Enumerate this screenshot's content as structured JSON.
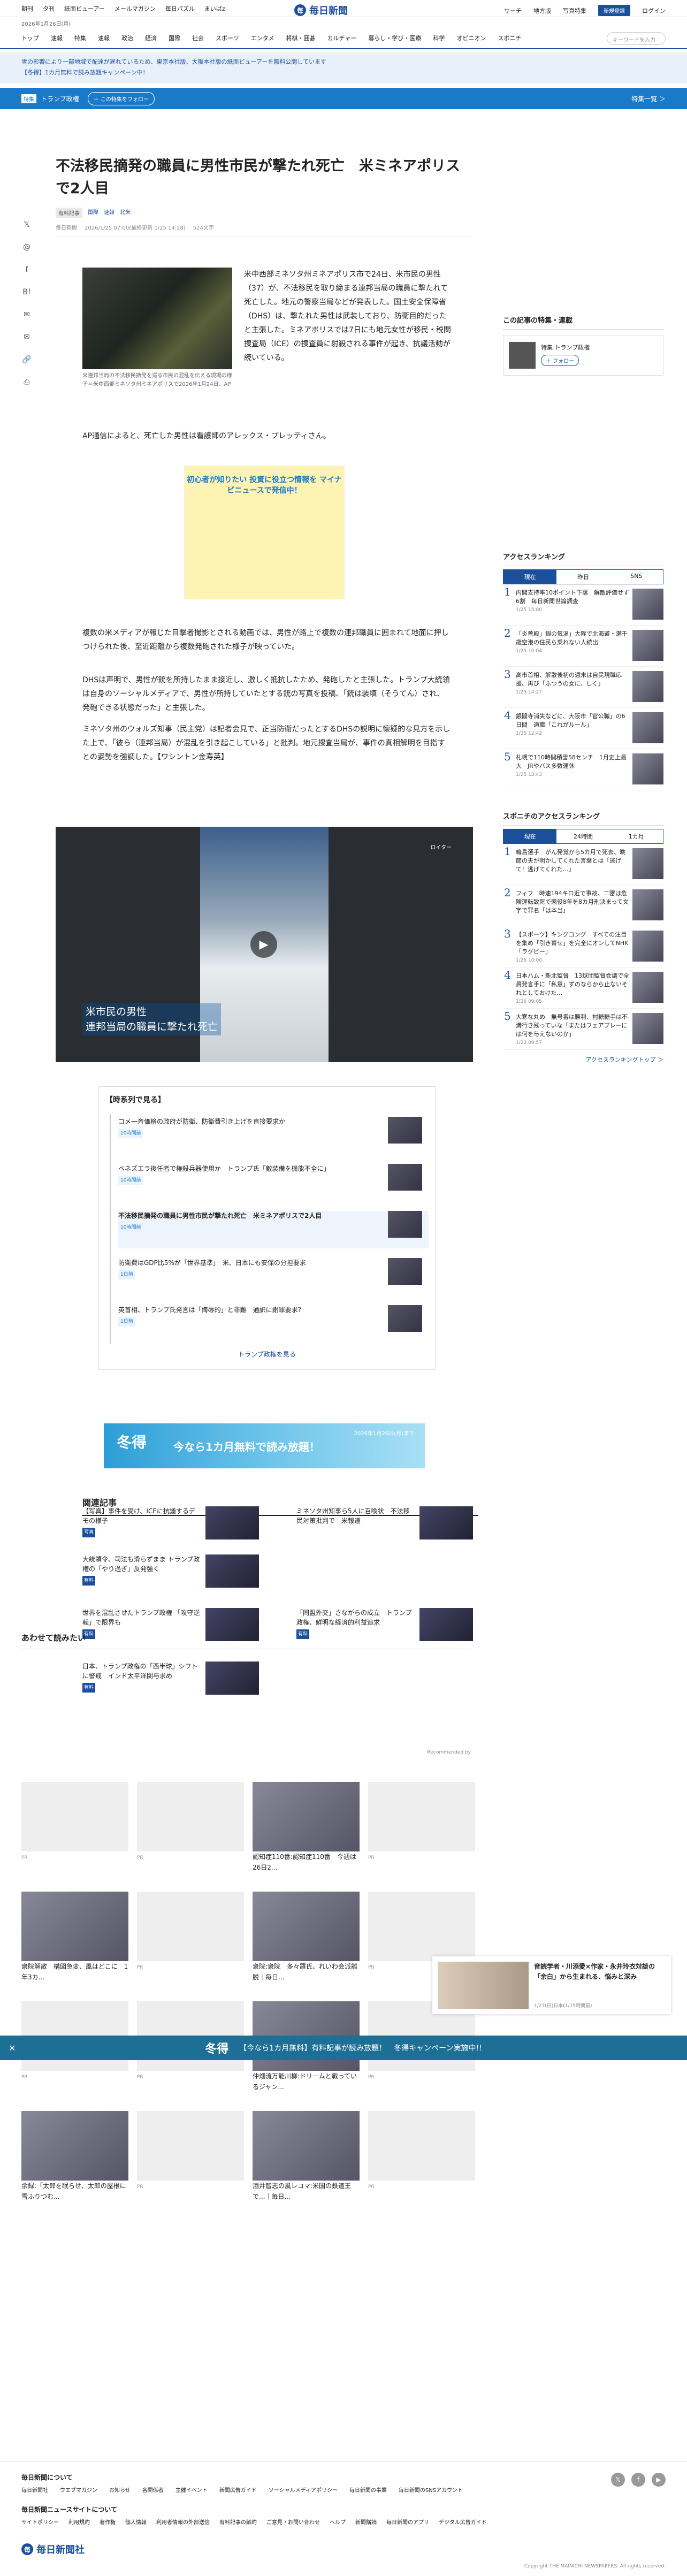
{
  "topnav": {
    "items": [
      "朝刊",
      "夕刊",
      "紙面ビューアー",
      "メールマガジン",
      "毎日パズル",
      "まいばz"
    ],
    "logo": "毎日新聞",
    "right": [
      "写真特集",
      "地方版",
      "サーチ"
    ],
    "subscribe": "新規登録",
    "login": "ログイン"
  },
  "date": "2026年1月26日(月)",
  "categories": [
    "トップ",
    "速報",
    "特集",
    "速報",
    "政治",
    "経済",
    "国際",
    "社会",
    "スポーツ",
    "エンタメ",
    "将棋・囲碁",
    "カルチャー",
    "暮らし・学び・医療",
    "科学",
    "オピニオン",
    "スポニチ"
  ],
  "search_placeholder": "キーワードを入力",
  "notices": [
    "雪の影響により一部地域で配達が遅れているため、東京本社版、大阪本社版の紙面ビューアーを無料公開しています",
    "【冬得】1カ月無料で読み放題キャンペーン中！"
  ],
  "topic": {
    "tag": "特集",
    "name": "トランプ政権",
    "follow": "＋ この特集をフォロー",
    "more": "特集一覧 ＞"
  },
  "article": {
    "title": "不法移民摘発の職員に男性市民が撃たれ死亡　米ミネアポリスで2人目",
    "tags": [
      "有料記事",
      "国際",
      "速報",
      "北米"
    ],
    "meta": [
      "毎日新聞",
      "2026/1/25 07:00(最終更新 1/25 14:28)",
      "524文字"
    ],
    "caption": "米連邦当局の不法移民摘発を巡る市民の混乱を伝える現場の様子＝米中西部ミネソタ州ミネアポリスで2026年1月24日、AP",
    "lead": "米中西部ミネソタ州ミネアポリス市で24日、米市民の男性（37）が、不法移民を取り締まる連邦当局の職員に撃たれて死亡した。地元の警察当局などが発表した。国土安全保障省（DHS）は、撃たれた男性は武装しており、防衛目的だったと主張した。ミネアポリスでは7日にも地元女性が移民・税関捜査局（ICE）の捜査員に射殺される事件が起き、抗議活動が続いている。",
    "p1": "AP通信によると、死亡した男性は看護師のアレックス・プレッティさん。",
    "p2": "複数の米メディアが報じた目撃者撮影とされる動画では、男性が路上で複数の連邦職員に囲まれて地面に押しつけられた後、至近距離から複数発砲された様子が映っていた。",
    "p3": "DHSは声明で、男性が銃を所持したまま接近し、激しく抵抗したため、発砲したと主張した。トランプ大統領は自身のソーシャルメディアで、男性が所持していたとする銃の写真を投稿、「銃は装填（そうてん）され、発砲できる状態だった」と主張した。",
    "p4": "ミネソタ州のウォルズ知事（民主党）は記者会見で、正当防衛だったとするDHSの説明に懐疑的な見方を示した上で、「彼ら（連邦当局）が混乱を引き起こしている」と批判。地元捜査当局が、事件の真相解明を目指すとの姿勢を強調した。【ワシントン金寿英】"
  },
  "ad1": {
    "title": "初心者が知りたい 投資に役立つ情報を マイナビニュースで発信中！",
    "note": "広告"
  },
  "video": {
    "title": "米市民の男性\n連邦当局の職員に撃たれ死亡",
    "brand": "ロイター"
  },
  "timeline": {
    "heading": "【時系列で見る】",
    "items": [
      {
        "title": "コメ一斉価格の政府が防衛、防衛費引き上げを直接要求か",
        "time": "10時間前"
      },
      {
        "title": "ベネズエラ後任者で権殺兵器使用か　トランプ氏「敵装備を機能不全に」",
        "time": "10時間前"
      },
      {
        "title": "不法移民摘発の職員に男性市民が撃たれ死亡　米ミネアポリスで2人目",
        "time": "10時間前"
      },
      {
        "title": "防衛費はGDP比5%が「世界基準」　米、日本にも安保の分担要求",
        "time": "1日前"
      },
      {
        "title": "英首相、トランプ氏発言は「侮辱的」と非難　通訳に謝罪要求？",
        "time": "1日前"
      }
    ],
    "more": "トランプ政権を見る"
  },
  "ad2": {
    "title": "冬得",
    "text": "今なら1カ月無料で読み放題！",
    "sub": "2026年1月26日(月)まで"
  },
  "related": {
    "heading": "関連記事",
    "items": [
      {
        "title": "【写真】事件を受け、ICEに抗議するデモの様子",
        "tag": "写真"
      },
      {
        "title": "ミネソタ州知事ら5人に召喚状　不法移民対策批判で　米報道",
        "tag": ""
      },
      {
        "title": "大統領令、司法も滑らずまま トランプ政権の「やり過ぎ」反発強く",
        "tag": "有料"
      },
      {
        "title": "",
        "tag": ""
      },
      {
        "title": "世界を混乱させたトランプ政権 「攻守逆転」で限界も",
        "tag": "有料"
      },
      {
        "title": "「同盟外交」さながらの成立　トランプ政権、鮮明な経済的利益追求",
        "tag": "有料"
      },
      {
        "title": "日本、トランプ政権の「西半球」シフトに警戒　インド太平洋関与求め",
        "tag": "有料"
      }
    ]
  },
  "suggest": {
    "heading": "あわせて読みたい",
    "recommended": "Recommended by",
    "cards": [
      {
        "title": "",
        "pr": "PR"
      },
      {
        "title": "",
        "pr": "PR"
      },
      {
        "title": "認知症110番:認知症110番　今週は26日2...",
        "pr": ""
      },
      {
        "title": "",
        "pr": "PR"
      },
      {
        "title": "衆院解散　構図急変、風はどこに　1年3カ...",
        "pr": ""
      },
      {
        "title": "",
        "pr": "PR"
      },
      {
        "title": "衆院:衆院　多々羅氏、れいわ会派離脱｜毎日...",
        "pr": ""
      },
      {
        "title": "",
        "pr": "PR"
      },
      {
        "title": "",
        "pr": "PR"
      },
      {
        "title": "",
        "pr": "PR"
      },
      {
        "title": "仲畑流万能川柳:ドリームと戦っているジャン...",
        "pr": ""
      },
      {
        "title": "",
        "pr": "PR"
      },
      {
        "title": "余録:「太郎を眠らせ、太郎の屋根に雪ふりつむ...",
        "pr": ""
      },
      {
        "title": "",
        "pr": "PR"
      },
      {
        "title": "酒井智志の風レコマ:米国の鉄道王で...｜毎日...",
        "pr": ""
      },
      {
        "title": "",
        "pr": "PR"
      }
    ]
  },
  "sidebar": {
    "topic_heading": "この記事の特集・連載",
    "topic_tag": "特集",
    "topic_name": "トランプ政権",
    "follow": "＋ フォロー",
    "ranking_heading": "アクセスランキング",
    "tabs": [
      "現在",
      "昨日",
      "SNS"
    ],
    "ranking": [
      {
        "n": "1",
        "title": "内閣支持率10ポイント下落　解散評価せず6割　毎日新聞世論調査",
        "time": "1/25 15:00"
      },
      {
        "n": "2",
        "title": "「炎曾殿」銀の気温」大隊で北海道・瀬千歳空港の住民ら乗れない人続出",
        "time": "1/25 10:04"
      },
      {
        "n": "3",
        "title": "高市首相、解散後初の週末は自民現職応援、再び「ふつうの女に、しく」",
        "time": "1/25 14:27"
      },
      {
        "n": "4",
        "title": "銀閣寺消失などに、大阪市「官公職」の6日間　適職「これがルール」",
        "time": "1/25 12:42"
      },
      {
        "n": "5",
        "title": "札幌で110時間積雪58センチ　1月史上最大　JRやバス多数運休",
        "time": "1/25 13:43"
      }
    ],
    "sports_heading": "スポニチのアクセスランキング",
    "sports_tabs": [
      "現在",
      "24時間",
      "1カ月"
    ],
    "sports": [
      {
        "n": "1",
        "title": "輪島選手　がん発覚から5カ月で死去、晩節の夫が明かしてくれた言葉とは「逃げて！逃げてくれた…」",
        "time": ""
      },
      {
        "n": "2",
        "title": "フィフ　時速194キロ近で事故、二審は危険運転致死で懲役8年を8カ月刑決まって文字で罪名「は本当」",
        "time": ""
      },
      {
        "n": "3",
        "title": "【スポーツ】キングコング　すべての注目を集め「引き寄せ」を完全にオンしてNHK「ラグビー」",
        "time": "1/26 10:00"
      },
      {
        "n": "4",
        "title": "日本ハム・新北監督　13球団監督会議で全員発言手に「私意」ずのならから止ないそれとしておけた…",
        "time": "1/26 09:05"
      },
      {
        "n": "5",
        "title": "大寒な丸め　無号番は勝利、村糖糖手は不満行き残っていな「またはフェアプレーには何を与えないのか」",
        "time": "1/22 09:57"
      }
    ],
    "sports_more": "アクセスランキングトップ ＞"
  },
  "bottom_ad": {
    "title": "冬得",
    "text": "【今なら1カ月無料】有料記事が読み放題！　冬得キャンペーン実施中!!"
  },
  "popup": {
    "title": "音読学者・川添愛×作家・永井玲衣対談の「余白」から生まれる、悩みと深み",
    "time": "1/27(日)日本(1/15時間前)"
  },
  "footer": {
    "about": "毎日新聞について",
    "links": [
      "毎日新聞社",
      "ウエブマガジン",
      "お知らせ",
      "各関係者",
      "主催イベント",
      "新聞広告ガイド",
      "ソーシャルメディアポリシー",
      "毎日新聞の事業",
      "毎日新聞のSNSアカウント"
    ],
    "group": "毎日新聞ニュースサイトについて",
    "group_links": [
      "サイトポリシー",
      "利用規約",
      "著作権",
      "個人情報",
      "利用者情報の外部送信",
      "有料記事の解約",
      "ご意見・お問い合わせ",
      "ヘルプ",
      "新聞購読",
      "毎日新聞のアプリ",
      "デジタル広告ガイド"
    ],
    "logo": "毎日新聞社",
    "copyright": "Copyright THE MAINICHI NEWSPAPERS. All rights reserved."
  }
}
